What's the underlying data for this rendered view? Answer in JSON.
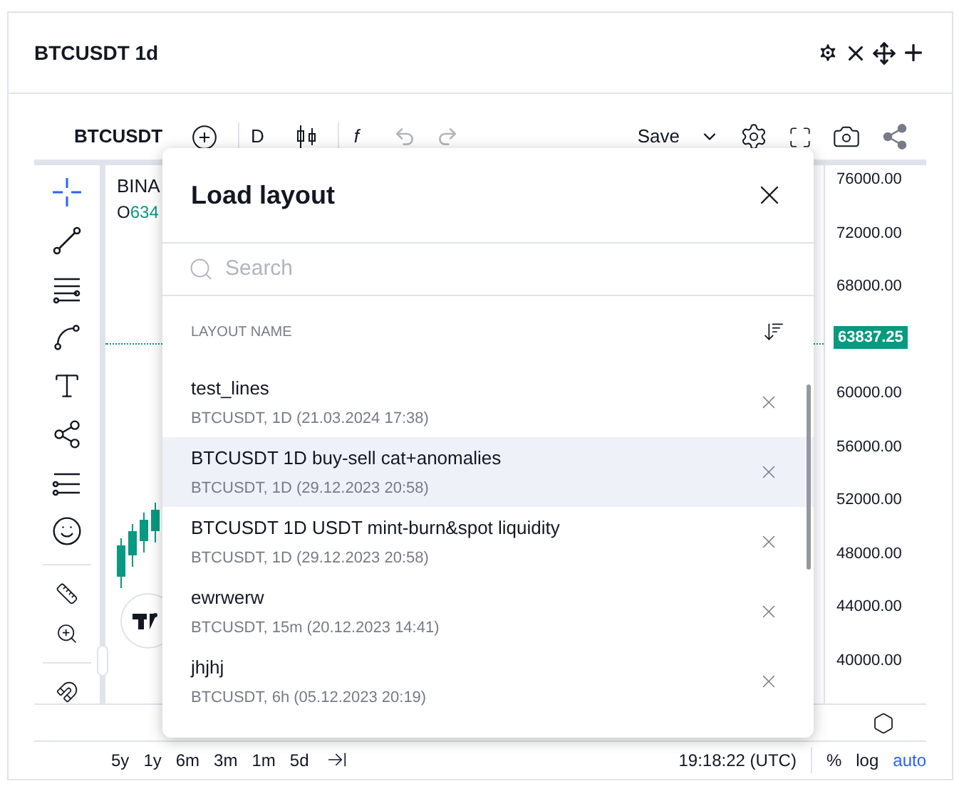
{
  "widget": {
    "title": "BTCUSDT 1d"
  },
  "toolbar": {
    "symbol": "BTCUSDT",
    "interval": "D",
    "indicators": "f",
    "save": "Save"
  },
  "legend": {
    "symbol": "BINA",
    "open_label": "O",
    "open_value": "634"
  },
  "price_scale": [
    {
      "label": "76000.00",
      "kind": "tick"
    },
    {
      "label": "72000.00",
      "kind": "tick"
    },
    {
      "label": "68000.00",
      "kind": "tick"
    },
    {
      "label": "63837.25",
      "kind": "current"
    },
    {
      "label": "60000.00",
      "kind": "tick"
    },
    {
      "label": "56000.00",
      "kind": "tick"
    },
    {
      "label": "52000.00",
      "kind": "tick"
    },
    {
      "label": "48000.00",
      "kind": "tick"
    },
    {
      "label": "44000.00",
      "kind": "tick"
    },
    {
      "label": "40000.00",
      "kind": "tick"
    }
  ],
  "range_bar": {
    "ranges": [
      "5y",
      "1y",
      "6m",
      "3m",
      "1m",
      "5d"
    ],
    "time": "19:18:22 (UTC)",
    "toggles": [
      {
        "label": "%",
        "on": false
      },
      {
        "label": "log",
        "on": false
      },
      {
        "label": "auto",
        "on": true
      }
    ]
  },
  "dialog": {
    "title": "Load layout",
    "search": {
      "placeholder": "Search"
    },
    "column": "LAYOUT NAME",
    "layouts": [
      {
        "name": "test_lines",
        "details": "BTCUSDT, 1D (21.03.2024 17:38)",
        "selected": false
      },
      {
        "name": "BTCUSDT 1D buy-sell cat+anomalies",
        "details": "BTCUSDT, 1D (29.12.2023 20:58)",
        "selected": true
      },
      {
        "name": "BTCUSDT 1D USDT mint-burn&spot liquidity",
        "details": "BTCUSDT, 1D (29.12.2023 20:58)",
        "selected": false
      },
      {
        "name": "ewrwerw",
        "details": "BTCUSDT, 15m (20.12.2023 14:41)",
        "selected": false
      },
      {
        "name": "jhjhj",
        "details": "BTCUSDT, 6h (05.12.2023 20:19)",
        "selected": false
      }
    ]
  }
}
